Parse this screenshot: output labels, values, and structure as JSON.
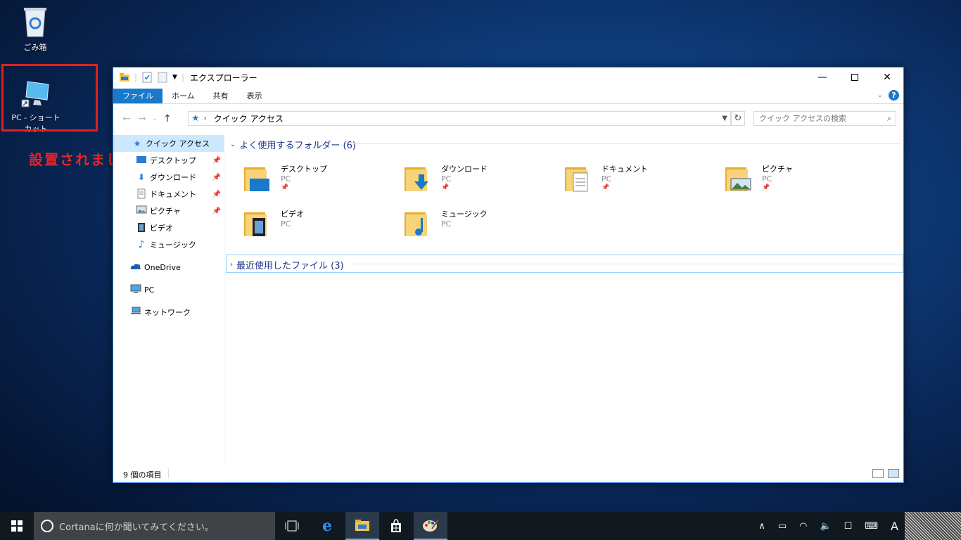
{
  "desktop": {
    "recycle_bin_label": "ごみ箱",
    "shortcut_label": "PC - ショートカット",
    "annotation": "設置されました"
  },
  "window": {
    "title": "エクスプローラー",
    "ribbon_tabs": [
      "ファイル",
      "ホーム",
      "共有",
      "表示"
    ],
    "address": "クイック アクセス",
    "search_placeholder": "クイック アクセスの検索",
    "sidebar": {
      "quick_access": "クイック アクセス",
      "items": [
        "デスクトップ",
        "ダウンロード",
        "ドキュメント",
        "ピクチャ",
        "ビデオ",
        "ミュージック"
      ],
      "onedrive": "OneDrive",
      "pc": "PC",
      "network": "ネットワーク"
    },
    "frequent_header": "よく使用するフォルダー (6)",
    "folders": [
      {
        "name": "デスクトップ",
        "location": "PC"
      },
      {
        "name": "ダウンロード",
        "location": "PC"
      },
      {
        "name": "ドキュメント",
        "location": "PC"
      },
      {
        "name": "ピクチャ",
        "location": "PC"
      },
      {
        "name": "ビデオ",
        "location": "PC"
      },
      {
        "name": "ミュージック",
        "location": "PC"
      }
    ],
    "recent_header": "最近使用したファイル (3)",
    "status_count": "9 個の項目"
  },
  "taskbar": {
    "search_placeholder": "Cortanaに何か聞いてみてください。",
    "ime_label": "A"
  },
  "colors": {
    "accent": "#1979ca",
    "annotation_red": "#e8242a",
    "group_header": "#1e3287"
  }
}
